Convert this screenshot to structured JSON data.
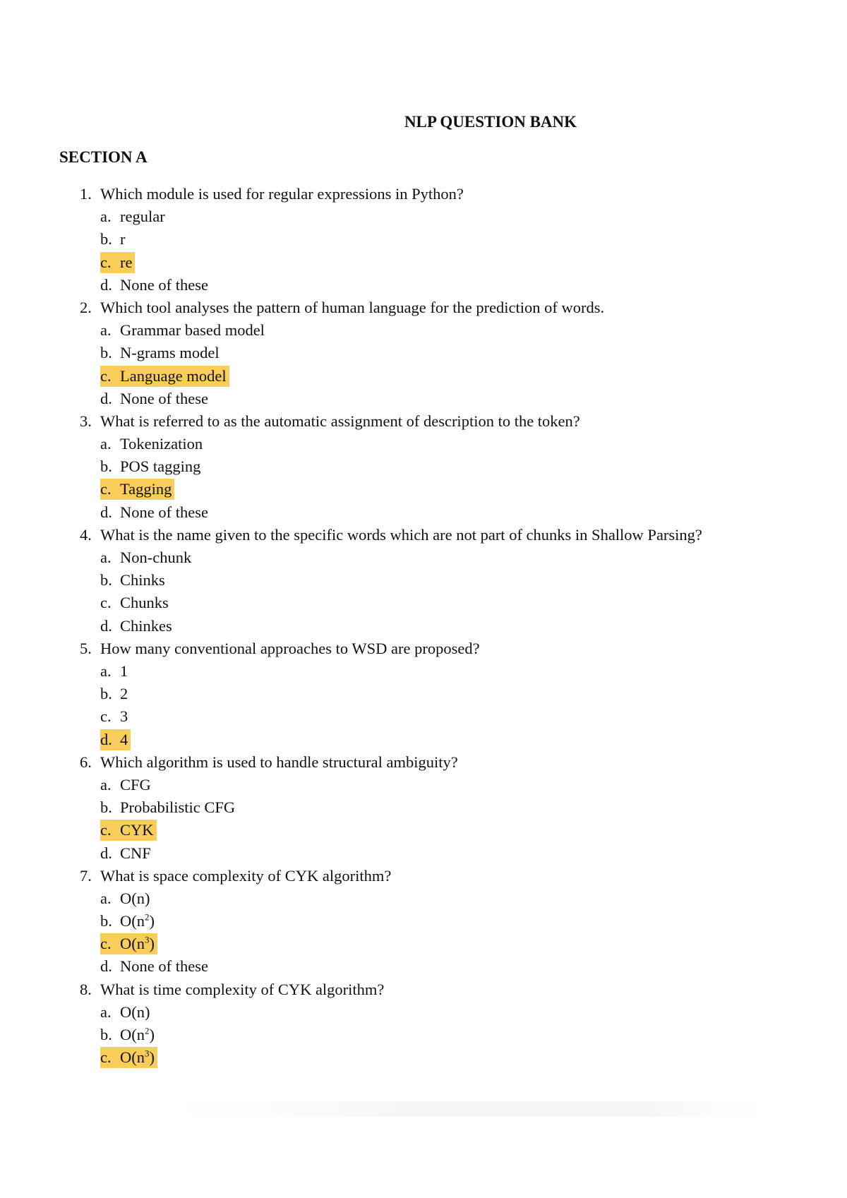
{
  "title": "NLP QUESTION BANK",
  "section": "SECTION A",
  "highlight_color": "#f9cd5a",
  "questions": [
    {
      "num": "1.",
      "text": "Which module is used for regular expressions in Python?",
      "options": [
        {
          "label": "a.",
          "text": "regular"
        },
        {
          "label": "b.",
          "text": "r"
        },
        {
          "label": "c.",
          "text": "re",
          "highlighted": true
        },
        {
          "label": "d.",
          "text": "None of these"
        }
      ]
    },
    {
      "num": "2.",
      "text": "Which tool analyses the pattern of human language for the prediction of words.",
      "options": [
        {
          "label": "a.",
          "text": "Grammar based model"
        },
        {
          "label": "b.",
          "text": "N-grams model"
        },
        {
          "label": "c.",
          "text": "Language model",
          "highlighted": true
        },
        {
          "label": "d.",
          "text": "None of these"
        }
      ]
    },
    {
      "num": "3.",
      "text": "What is referred to as the automatic assignment of description to the token?",
      "options": [
        {
          "label": "a.",
          "text": "Tokenization"
        },
        {
          "label": "b.",
          "text": "POS tagging"
        },
        {
          "label": "c.",
          "text": "Tagging",
          "highlighted": true
        },
        {
          "label": "d.",
          "text": "None of these"
        }
      ]
    },
    {
      "num": "4.",
      "text": "What is the name given to the specific words which are not part of chunks in Shallow Parsing?",
      "options": [
        {
          "label": "a.",
          "text": "Non-chunk"
        },
        {
          "label": "b.",
          "text": "Chinks"
        },
        {
          "label": "c.",
          "text": "Chunks"
        },
        {
          "label": "d.",
          "text": "Chinkes"
        }
      ]
    },
    {
      "num": "5.",
      "text": "How many conventional approaches to WSD are proposed?",
      "options": [
        {
          "label": "a.",
          "text": "1"
        },
        {
          "label": "b.",
          "text": "2"
        },
        {
          "label": "c.",
          "text": "3"
        },
        {
          "label": "d.",
          "text": "4",
          "highlighted": true
        }
      ]
    },
    {
      "num": "6.",
      "text": "Which algorithm is used to handle structural ambiguity?",
      "options": [
        {
          "label": "a.",
          "text": "CFG"
        },
        {
          "label": "b.",
          "text": "Probabilistic CFG"
        },
        {
          "label": "c.",
          "text": "CYK",
          "highlighted": true
        },
        {
          "label": "d.",
          "text": "CNF"
        }
      ]
    },
    {
      "num": "7.",
      "text": "What is space complexity of CYK algorithm?",
      "options": [
        {
          "label": "a.",
          "text": "O(n)"
        },
        {
          "label": "b.",
          "text": "O(n",
          "sup": "2",
          "after": ")"
        },
        {
          "label": "c.",
          "text": "O(n",
          "sup": "3",
          "after": ")",
          "highlighted": true
        },
        {
          "label": "d.",
          "text": "None of these"
        }
      ]
    },
    {
      "num": "8.",
      "text": "What is time complexity of CYK algorithm?",
      "options": [
        {
          "label": "a.",
          "text": "O(n)"
        },
        {
          "label": "b.",
          "text": "O(n",
          "sup": "2",
          "after": ")"
        },
        {
          "label": "c.",
          "text": "O(n",
          "sup": "3",
          "after": ")",
          "highlighted": true
        }
      ]
    }
  ]
}
